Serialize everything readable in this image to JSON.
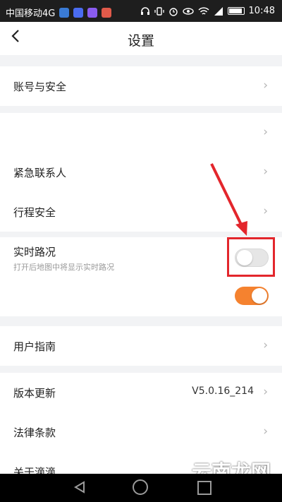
{
  "status_bar": {
    "carrier": "中国移动4G",
    "time": "10:48",
    "app_icon_colors": [
      "#3a7bd5",
      "#4a6cf0",
      "#8a5cf0",
      "#e05a4a"
    ],
    "icons": [
      "headset-icon",
      "vibrate-icon",
      "alarm-icon",
      "eye-icon",
      "wifi-icon",
      "signal-icon",
      "battery-icon"
    ]
  },
  "header": {
    "back_icon": "chevron-left-icon",
    "title": "设置"
  },
  "settings": {
    "account_security": "账号与安全",
    "emergency_contact": "紧急联系人",
    "trip_safety": "行程安全",
    "realtime_traffic": {
      "label": "实时路况",
      "description": "打开后地图中将显示实时路况",
      "enabled": false
    },
    "extra_toggle_enabled": true,
    "user_guide": "用户指南",
    "version_update": {
      "label": "版本更新",
      "value": "V5.0.16_214"
    },
    "legal_terms": "法律条款",
    "about": "关于滴滴"
  },
  "chevron_glyph": "›",
  "annotation": {
    "arrow_color": "#e3262c",
    "highlight_color": "#e3262c"
  },
  "watermark": "云南龙网",
  "accent_color": "#f5822f"
}
